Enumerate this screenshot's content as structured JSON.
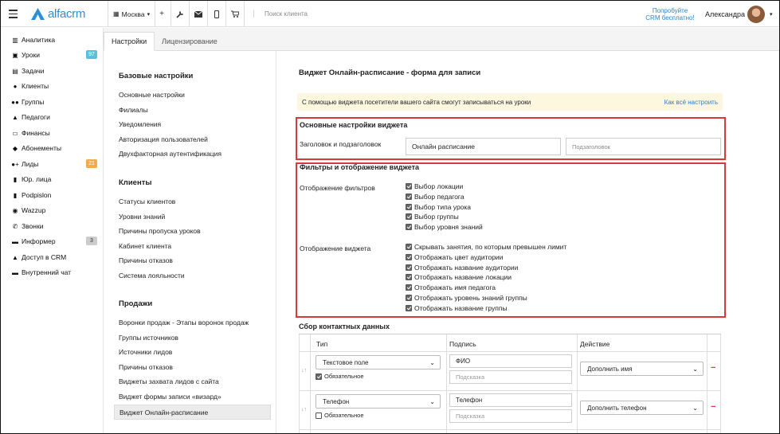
{
  "topbar": {
    "logo_text": "alfacrm",
    "city": "Москва",
    "city_caret": "▾",
    "search_placeholder": "Поиск клиента",
    "promo_line1": "Попробуйте",
    "promo_line2": "CRM бесплатно!",
    "user_name": "Александра",
    "user_caret": "▾",
    "icons": [
      "hamburger-icon",
      "plus-icon",
      "wrench-icon",
      "mail-icon",
      "phone-icon",
      "cart-icon"
    ]
  },
  "sidebar": {
    "items": [
      {
        "label": "Аналитика",
        "icon": "analytics-icon",
        "glyph": "▥"
      },
      {
        "label": "Уроки",
        "icon": "calendar-icon",
        "glyph": "▣",
        "badge": "97",
        "badge_color": "#5bc0de"
      },
      {
        "label": "Задачи",
        "icon": "tasks-icon",
        "glyph": "▤"
      },
      {
        "label": "Клиенты",
        "icon": "user-icon",
        "glyph": "●"
      },
      {
        "label": "Группы",
        "icon": "users-icon",
        "glyph": "●●"
      },
      {
        "label": "Педагоги",
        "icon": "teacher-icon",
        "glyph": "▲"
      },
      {
        "label": "Финансы",
        "icon": "money-icon",
        "glyph": "▭"
      },
      {
        "label": "Абонементы",
        "icon": "tag-icon",
        "glyph": "◆"
      },
      {
        "label": "Лиды",
        "icon": "leads-icon",
        "glyph": "●+",
        "badge": "21",
        "badge_color": "#f0ad4e"
      },
      {
        "label": "Юр. лица",
        "icon": "building-icon",
        "glyph": "▮"
      },
      {
        "label": "Podpislon",
        "icon": "file-icon",
        "glyph": "▮"
      },
      {
        "label": "Wazzup",
        "icon": "whatsapp-icon",
        "glyph": "◉"
      },
      {
        "label": "Звонки",
        "icon": "call-icon",
        "glyph": "✆"
      },
      {
        "label": "Информер",
        "icon": "informer-icon",
        "glyph": "▬",
        "badge": "3",
        "badge_color": "#ccc"
      },
      {
        "label": "Доступ в CRM",
        "icon": "lock-icon",
        "glyph": "▲"
      },
      {
        "label": "Внутренний чат",
        "icon": "chat-icon",
        "glyph": "▬"
      }
    ]
  },
  "tabs": [
    {
      "label": "Настройки"
    },
    {
      "label": "Лицензирование"
    }
  ],
  "settings_nav": {
    "sections": [
      {
        "title": "Базовые настройки",
        "links": [
          "Основные настройки",
          "Филиалы",
          "Уведомления",
          "Авторизация пользователей",
          "Двухфакторная аутентификация"
        ]
      },
      {
        "title": "Клиенты",
        "links": [
          "Статусы клиентов",
          "Уровни знаний",
          "Причины пропуска уроков",
          "Кабинет клиента",
          "Причины отказов",
          "Система лояльности"
        ]
      },
      {
        "title": "Продажи",
        "links": [
          "Воронки продаж - Этапы воронок продаж",
          "Группы источников",
          "Источники лидов",
          "Причины отказов",
          "Виджеты захвата лидов с сайта",
          "Виджет формы записи «визард»",
          "Виджет Онлайн-расписание"
        ]
      }
    ]
  },
  "main": {
    "title": "Виджет Онлайн-расписание - форма для записи",
    "notice_text": "С помощью виджета посетители вашего сайта смогут записываться на уроки",
    "notice_link": "Как всё настроить",
    "basic": {
      "header": "Основные настройки виджета",
      "label": "Заголовок и подзаголовок",
      "title_value": "Онлайн расписание",
      "subtitle_placeholder": "Подзаголовок"
    },
    "filters": {
      "header": "Фильтры и отображение виджета",
      "filters_label": "Отображение фильтров",
      "filter_options": [
        "Выбор локации",
        "Выбор педагога",
        "Выбор типа урока",
        "Выбор группы",
        "Выбор уровня знаний"
      ],
      "display_label": "Отображение виджета",
      "display_options": [
        "Скрывать занятия, по которым превышен лимит",
        "Отображать цвет аудитории",
        "Отображать название аудитории",
        "Отображать название локации",
        "Отображать имя педагога",
        "Отображать уровень знаний группы",
        "Отображать название группы"
      ]
    },
    "contacts": {
      "header": "Сбор контактных данных",
      "columns": [
        "Тип",
        "Подпись",
        "Действие"
      ],
      "rows": [
        {
          "type": "Текстовое поле",
          "required": "Обязательное",
          "required_checked": true,
          "label": "ФИО",
          "hint_placeholder": "Подсказка",
          "action": "Дополнить имя"
        },
        {
          "type": "Телефон",
          "required": "Обязательное",
          "required_checked": false,
          "label": "Телефон",
          "hint_placeholder": "Подсказка",
          "action": "Дополнить телефон"
        }
      ],
      "drag_glyph": "↓↑",
      "remove_glyph": "−",
      "select_chevron": "⌄"
    }
  },
  "colors": {
    "brand": "#2c8fd6",
    "highlight_border": "#d63b3b",
    "notice_bg": "#fdf7e0",
    "remove": "#d63b3b"
  }
}
